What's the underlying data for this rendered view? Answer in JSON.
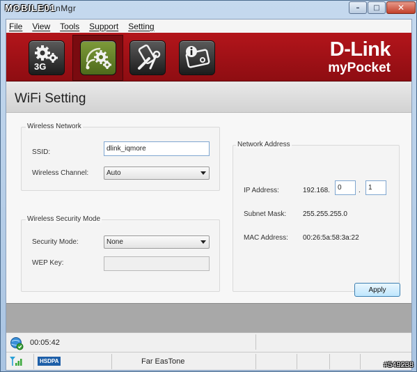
{
  "window": {
    "title_logo": "MOBILE01",
    "title_suffix": "nMgr",
    "min_glyph": "–",
    "max_glyph": "□",
    "close_glyph": "✕"
  },
  "menu": {
    "items": [
      {
        "label": "File"
      },
      {
        "label": "View"
      },
      {
        "label": "Tools"
      },
      {
        "label": "Support"
      },
      {
        "label": "Setting"
      }
    ]
  },
  "banner": {
    "brand": "D-Link",
    "product": "myPocket",
    "nav": [
      {
        "icon": "3g-settings-icon",
        "label": "3G"
      },
      {
        "icon": "wifi-settings-icon"
      },
      {
        "icon": "phone-tools-icon"
      },
      {
        "icon": "info-icon"
      }
    ],
    "active_index": 1,
    "colors": {
      "banner": "#a3121a",
      "active_button": "#6a8a2c"
    }
  },
  "page": {
    "title": "WiFi Setting"
  },
  "wireless_network": {
    "group_label": "Wireless Network",
    "ssid_label": "SSID:",
    "ssid_value": "dlink_iqmore",
    "channel_label": "Wireless Channel:",
    "channel_value": "Auto"
  },
  "security": {
    "group_label": "Wireless Security Mode",
    "mode_label": "Security Mode:",
    "mode_value": "None",
    "wep_label": "WEP Key:",
    "wep_value": ""
  },
  "network_address": {
    "group_label": "Network Address",
    "ip_label": "IP Address:",
    "ip_prefix": "192.168.",
    "ip_octet3": "0",
    "ip_dot": ".",
    "ip_octet4": "1",
    "subnet_label": "Subnet Mask:",
    "subnet_value": "255.255.255.0",
    "mac_label": "MAC Address:",
    "mac_value": "00:26:5a:58:3a:22"
  },
  "buttons": {
    "apply": "Apply"
  },
  "status": {
    "elapsed": "00:05:42",
    "network_type": "HSDPA",
    "carrier": "Far EasTone"
  },
  "watermark": "#549238"
}
